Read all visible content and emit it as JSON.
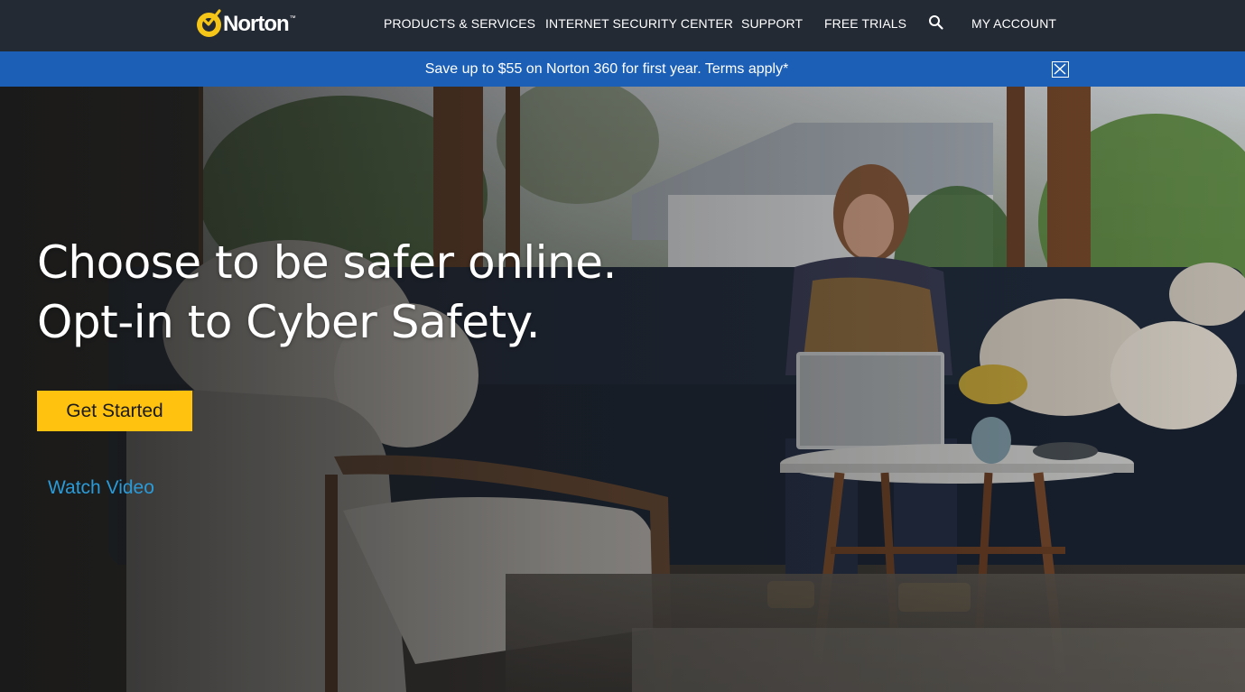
{
  "brand": {
    "name": "Norton",
    "trademark": "™",
    "accent_color": "#ffc20e",
    "nav_bg": "#232a34",
    "banner_bg": "#1b5fb7",
    "link_color": "#2a9bd8"
  },
  "nav": {
    "items": [
      {
        "label": "PRODUCTS & SERVICES"
      },
      {
        "label": "INTERNET SECURITY CENTER"
      },
      {
        "label": "SUPPORT"
      },
      {
        "label": "FREE TRIALS"
      },
      {
        "label": "MY ACCOUNT"
      }
    ],
    "search_icon": "search-icon"
  },
  "promo": {
    "text": "Save up to $55 on Norton 360 for first year. Terms apply*",
    "close_icon": "close-icon"
  },
  "hero": {
    "headline_line1": "Choose to be safer online.",
    "headline_line2": "Opt-in to Cyber Safety.",
    "cta_label": "Get Started",
    "video_link": "Watch Video"
  }
}
